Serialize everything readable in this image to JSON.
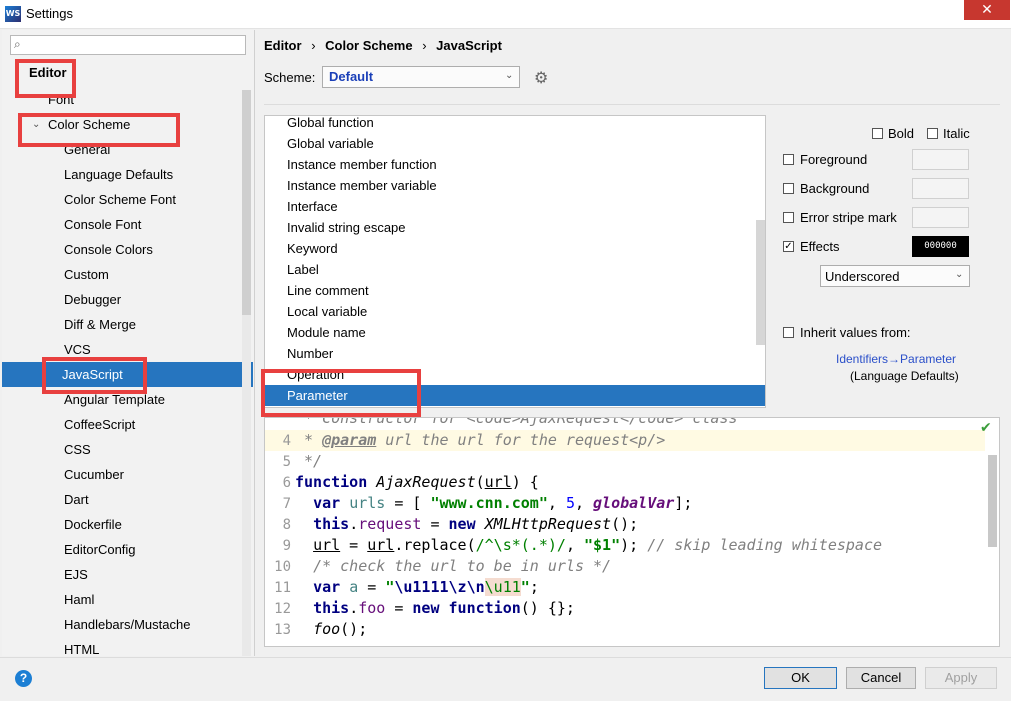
{
  "window": {
    "title": "Settings",
    "app_icon": "WS",
    "close_glyph": "✕"
  },
  "search": {
    "placeholder": "",
    "icon": "search-icon"
  },
  "tree": {
    "items": [
      {
        "label": "Editor",
        "bold": true
      },
      {
        "label": "Font"
      },
      {
        "label": "Color Scheme",
        "expanded": true
      },
      {
        "label": "General"
      },
      {
        "label": "Language Defaults"
      },
      {
        "label": "Color Scheme Font"
      },
      {
        "label": "Console Font"
      },
      {
        "label": "Console Colors"
      },
      {
        "label": "Custom"
      },
      {
        "label": "Debugger"
      },
      {
        "label": "Diff & Merge"
      },
      {
        "label": "VCS"
      },
      {
        "label": "JavaScript",
        "selected": true
      },
      {
        "label": "Angular Template"
      },
      {
        "label": "CoffeeScript"
      },
      {
        "label": "CSS"
      },
      {
        "label": "Cucumber"
      },
      {
        "label": "Dart"
      },
      {
        "label": "Dockerfile"
      },
      {
        "label": "EditorConfig"
      },
      {
        "label": "EJS"
      },
      {
        "label": "Haml"
      },
      {
        "label": "Handlebars/Mustache"
      },
      {
        "label": "HTML"
      }
    ]
  },
  "breadcrumb": {
    "part1": "Editor",
    "part2": "Color Scheme",
    "part3": "JavaScript",
    "sep": "›"
  },
  "scheme": {
    "label": "Scheme:",
    "value": "Default"
  },
  "attributes": {
    "items": [
      "Global function",
      "Global variable",
      "Instance member function",
      "Instance member variable",
      "Interface",
      "Invalid string escape",
      "Keyword",
      "Label",
      "Line comment",
      "Local variable",
      "Module name",
      "Number",
      "Operation",
      "Parameter"
    ],
    "selected": "Parameter"
  },
  "properties": {
    "bold": "Bold",
    "italic": "Italic",
    "foreground": "Foreground",
    "background": "Background",
    "error_stripe": "Error stripe mark",
    "effects": "Effects",
    "effects_checked": true,
    "effect_color": "000000",
    "effect_type": "Underscored",
    "inherit": "Inherit values from:",
    "inherit_link": "Identifiers→Parameter",
    "inherit_sub": "(Language Defaults)"
  },
  "code": {
    "line3": " * Constructor for <code>AjaxRequest</code> class",
    "ln4": "4",
    "ln5": "5",
    "ln6": "6",
    "ln7": "7",
    "ln8": "8",
    "ln9": "9",
    "ln10": "10",
    "ln11": "11",
    "ln12": "12",
    "ln13": "13"
  },
  "buttons": {
    "ok": "OK",
    "cancel": "Cancel",
    "apply": "Apply"
  },
  "colors": {
    "accent": "#2675bf",
    "annotation": "#e8403f"
  }
}
